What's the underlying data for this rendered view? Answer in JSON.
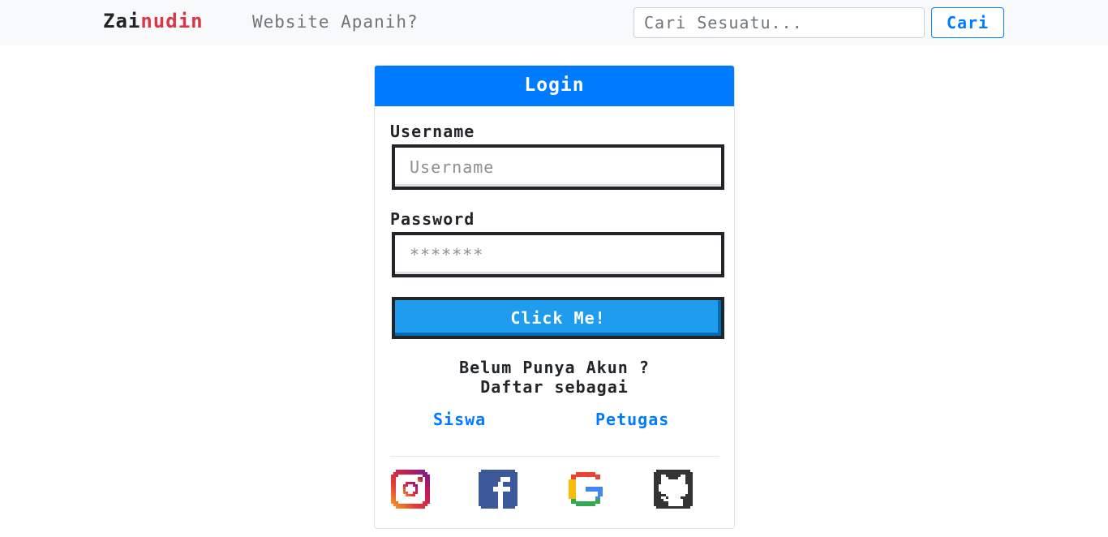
{
  "navbar": {
    "brand_part1": "Zai",
    "brand_part2": "nudin",
    "tagline": "Website Apanih?",
    "search_placeholder": "Cari Sesuatu...",
    "search_button": "Cari"
  },
  "login": {
    "title": "Login",
    "username_label": "Username",
    "username_placeholder": "Username",
    "password_label": "Password",
    "password_placeholder": "*******",
    "submit_label": "Click Me!",
    "register_line1": "Belum Punya Akun ?",
    "register_line2": "Daftar sebagai",
    "link_siswa": "Siswa",
    "link_petugas": "Petugas"
  },
  "social": [
    "instagram-icon",
    "facebook-icon",
    "google-icon",
    "github-icon"
  ],
  "colors": {
    "primary": "#007bff",
    "brand_accent": "#dc3545",
    "button": "#209cee",
    "navbar_bg": "#f8f9fa"
  }
}
